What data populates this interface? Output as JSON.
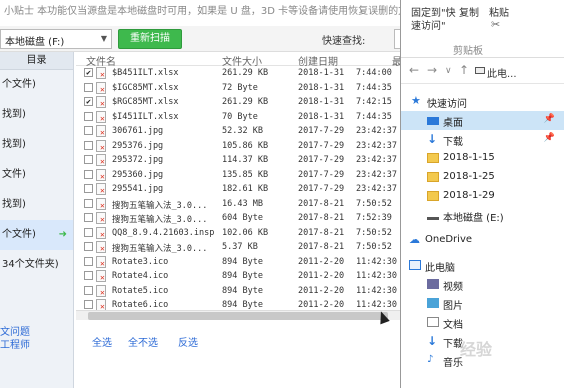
{
  "tip": "小贴士 本功能仅当源盘是本地磁盘时可用，如果是 U 盘，3D 卡等设备请使用恢复误删的文件",
  "toolbar": {
    "drive": "本地磁盘 (F:)",
    "rescan": "重新扫描",
    "quick_search": "快速查找:"
  },
  "sidebar": {
    "header": "目录",
    "items": [
      {
        "label": "个文件)"
      },
      {
        "label": "找到)"
      },
      {
        "label": "找到)"
      },
      {
        "label": "文件)"
      },
      {
        "label": "找到)"
      },
      {
        "label": "个文件)",
        "arrow": "➜"
      },
      {
        "label": "34个文件夹)"
      }
    ],
    "bottom1": "文问题",
    "bottom2": "工程师"
  },
  "columns": {
    "name": "文件名",
    "size": "文件大小",
    "created": "创建日期",
    "extra": "最"
  },
  "files": [
    {
      "checked": "✔",
      "name": "$B451ILT.xlsx",
      "size": "261.29 KB",
      "date": "2018-1-31",
      "time": "7:44:00"
    },
    {
      "checked": "",
      "name": "$IGC85MT.xlsx",
      "size": "72 Byte",
      "date": "2018-1-31",
      "time": "7:44:35"
    },
    {
      "checked": "✔",
      "name": "$RGC85MT.xlsx",
      "size": "261.29 KB",
      "date": "2018-1-31",
      "time": "7:42:15"
    },
    {
      "checked": "",
      "name": "$I451ILT.xlsx",
      "size": "70 Byte",
      "date": "2018-1-31",
      "time": "7:44:35"
    },
    {
      "checked": "",
      "name": "306761.jpg",
      "size": "52.32 KB",
      "date": "2017-7-29",
      "time": "23:42:37"
    },
    {
      "checked": "",
      "name": "295376.jpg",
      "size": "105.86 KB",
      "date": "2017-7-29",
      "time": "23:42:37"
    },
    {
      "checked": "",
      "name": "295372.jpg",
      "size": "114.37 KB",
      "date": "2017-7-29",
      "time": "23:42:37"
    },
    {
      "checked": "",
      "name": "295360.jpg",
      "size": "135.85 KB",
      "date": "2017-7-29",
      "time": "23:42:37"
    },
    {
      "checked": "",
      "name": "295541.jpg",
      "size": "182.61 KB",
      "date": "2017-7-29",
      "time": "23:42:37"
    },
    {
      "checked": "",
      "name": "搜狗五笔输入法_3.0...",
      "size": "16.43 MB",
      "date": "2017-8-21",
      "time": "7:50:52"
    },
    {
      "checked": "",
      "name": "搜狗五笔输入法_3.0...",
      "size": "604 Byte",
      "date": "2017-8-21",
      "time": "7:52:39"
    },
    {
      "checked": "",
      "name": "QQ8_8.9.4.21603.insp",
      "size": "102.06 KB",
      "date": "2017-8-21",
      "time": "7:50:52"
    },
    {
      "checked": "",
      "name": "搜狗五笔输入法_3.0...",
      "size": "5.37 KB",
      "date": "2017-8-21",
      "time": "7:50:52"
    },
    {
      "checked": "",
      "name": "Rotate3.ico",
      "size": "894 Byte",
      "date": "2011-2-20",
      "time": "11:42:30"
    },
    {
      "checked": "",
      "name": "Rotate4.ico",
      "size": "894 Byte",
      "date": "2011-2-20",
      "time": "11:42:30"
    },
    {
      "checked": "",
      "name": "Rotate5.ico",
      "size": "894 Byte",
      "date": "2011-2-20",
      "time": "11:42:30"
    },
    {
      "checked": "",
      "name": "Rotate6.ico",
      "size": "894 Byte",
      "date": "2011-2-20",
      "time": "11:42:30"
    }
  ],
  "actions": {
    "select_all": "全选",
    "select_none": "全不选",
    "invert": "反选"
  },
  "explorer": {
    "ribbon": {
      "pin_line1": "固定到\"快",
      "pin_line2": "速访问\"",
      "copy": "复制",
      "paste": "粘贴",
      "group": "剪贴板"
    },
    "address": "此电...",
    "tree": [
      {
        "label": "快速访问",
        "icon": "star-icon",
        "type": "quick"
      },
      {
        "label": "桌面",
        "icon": "desktop-icon",
        "type": "sub",
        "pin": "📌",
        "selected": true
      },
      {
        "label": "下载",
        "icon": "download-icon",
        "type": "sub",
        "pin": "📌"
      },
      {
        "label": "2018-1-15",
        "icon": "folder-icon",
        "type": "sub"
      },
      {
        "label": "2018-1-25",
        "icon": "folder-icon",
        "type": "sub"
      },
      {
        "label": "2018-1-29",
        "icon": "folder-icon",
        "type": "sub"
      },
      {
        "label": "本地磁盘 (E:)",
        "icon": "drive-icon",
        "type": "sub"
      },
      {
        "label": "",
        "icon": "",
        "type": "gap"
      },
      {
        "label": "OneDrive",
        "icon": "cloud-icon",
        "type": "top"
      },
      {
        "label": "",
        "icon": "",
        "type": "gap"
      },
      {
        "label": "此电脑",
        "icon": "computer-icon",
        "type": "top"
      },
      {
        "label": "视频",
        "icon": "video-icon",
        "type": "sub"
      },
      {
        "label": "图片",
        "icon": "picture-icon",
        "type": "sub"
      },
      {
        "label": "文档",
        "icon": "document-icon",
        "type": "sub"
      },
      {
        "label": "下载",
        "icon": "download-icon",
        "type": "sub"
      },
      {
        "label": "音乐",
        "icon": "music-icon",
        "type": "sub"
      }
    ]
  },
  "watermark": "经验"
}
